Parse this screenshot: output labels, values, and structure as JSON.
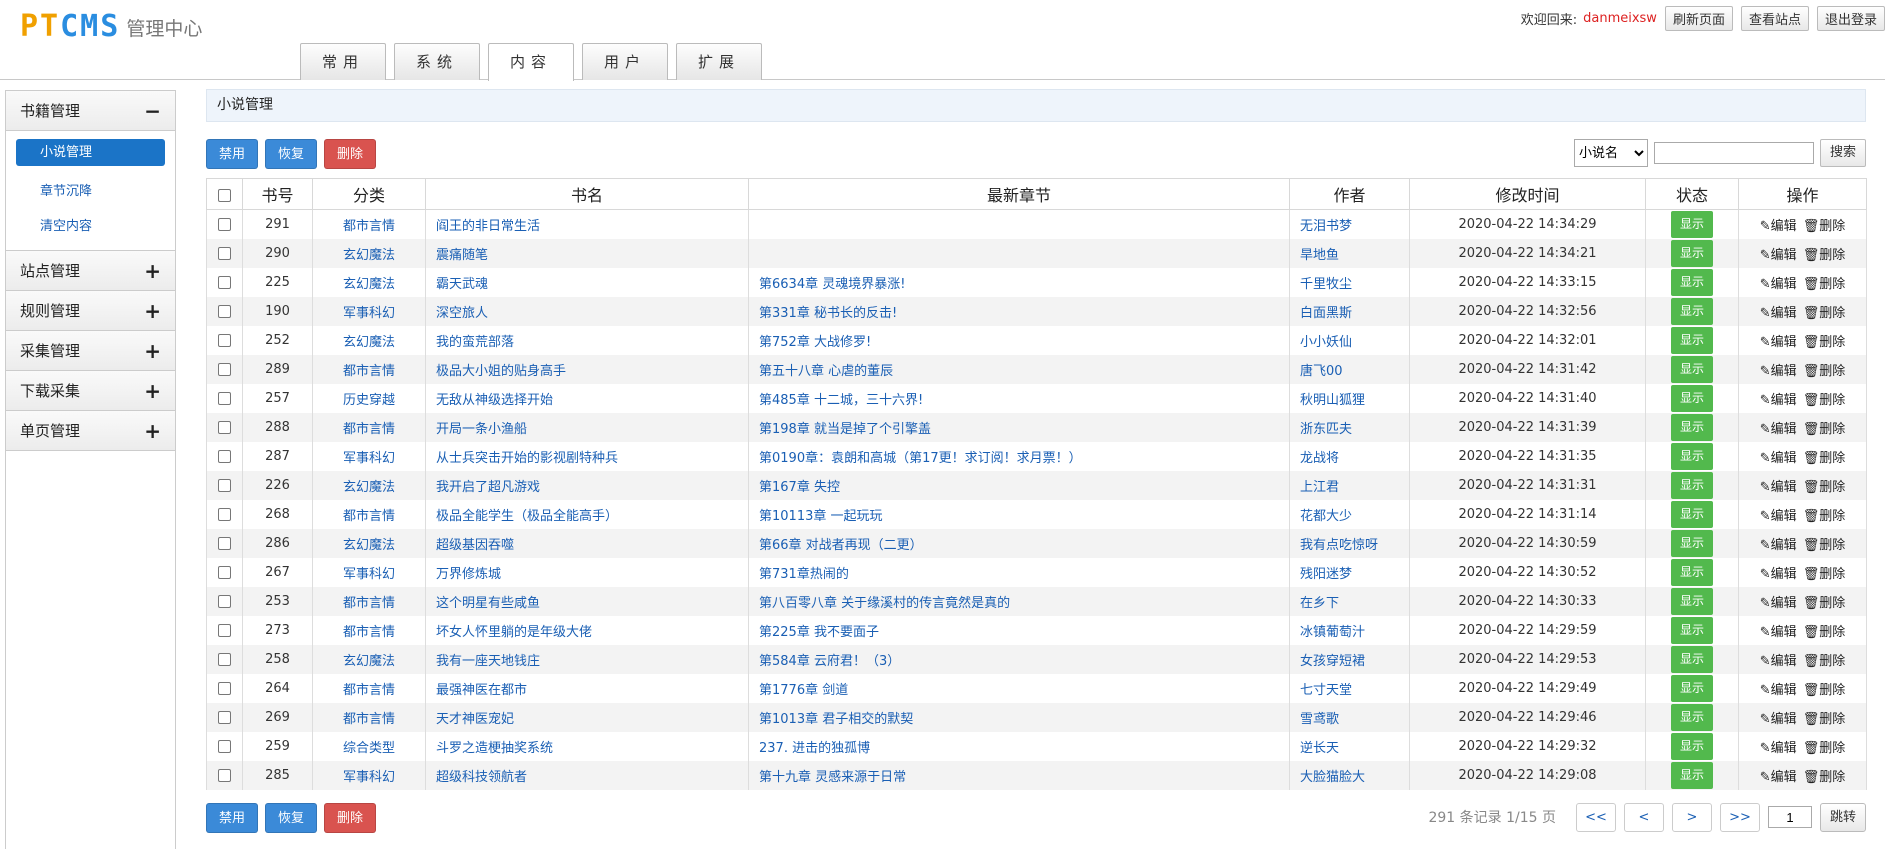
{
  "header": {
    "logo_brand_1": "PT",
    "logo_brand_2": "CMS",
    "logo_sub": "管理中心",
    "welcome": "欢迎回来:",
    "username": "danmeixsw",
    "refresh_label": "刷新页面",
    "view_site_label": "查看站点",
    "logout_label": "退出登录"
  },
  "tabs": [
    {
      "label": "常用"
    },
    {
      "label": "系统"
    },
    {
      "label": "内容"
    },
    {
      "label": "用户"
    },
    {
      "label": "扩展"
    }
  ],
  "sidebar": {
    "groups": [
      {
        "label": "书籍管理",
        "sign": "−"
      },
      {
        "label": "站点管理",
        "sign": "+"
      },
      {
        "label": "规则管理",
        "sign": "+"
      },
      {
        "label": "采集管理",
        "sign": "+"
      },
      {
        "label": "下载采集",
        "sign": "+"
      },
      {
        "label": "单页管理",
        "sign": "+"
      }
    ],
    "items": [
      {
        "label": "小说管理"
      },
      {
        "label": "章节沉降"
      },
      {
        "label": "清空内容"
      }
    ]
  },
  "main": {
    "crumb": "小说管理",
    "actions": {
      "disable": "禁用",
      "restore": "恢复",
      "delete": "删除"
    },
    "search": {
      "select_value": "小说名",
      "button": "搜索",
      "input_value": ""
    },
    "columns": [
      "书号",
      "分类",
      "书名",
      "最新章节",
      "作者",
      "修改时间",
      "状态",
      "操作"
    ],
    "status_label": "显示",
    "edit_label": "编辑",
    "delete_label": "删除",
    "rows": [
      {
        "id": "291",
        "cat": "都市言情",
        "name": "阎王的非日常生活",
        "chapter": "",
        "author": "无泪书梦",
        "time": "2020-04-22 14:34:29"
      },
      {
        "id": "290",
        "cat": "玄幻魔法",
        "name": "震痛随笔",
        "chapter": "",
        "author": "旱地鱼",
        "time": "2020-04-22 14:34:21"
      },
      {
        "id": "225",
        "cat": "玄幻魔法",
        "name": "霸天武魂",
        "chapter": "第6634章 灵魂境界暴涨!",
        "author": "千里牧尘",
        "time": "2020-04-22 14:33:15"
      },
      {
        "id": "190",
        "cat": "军事科幻",
        "name": "深空旅人",
        "chapter": "第331章 秘书长的反击!",
        "author": "白面黑斯",
        "time": "2020-04-22 14:32:56"
      },
      {
        "id": "252",
        "cat": "玄幻魔法",
        "name": "我的蛮荒部落",
        "chapter": "第752章 大战修罗!",
        "author": "小小妖仙",
        "time": "2020-04-22 14:32:01"
      },
      {
        "id": "289",
        "cat": "都市言情",
        "name": "极品大小姐的贴身高手",
        "chapter": "第五十八章 心虐的董辰",
        "author": "唐飞00",
        "time": "2020-04-22 14:31:42"
      },
      {
        "id": "257",
        "cat": "历史穿越",
        "name": "无敌从神级选择开始",
        "chapter": "第485章 十二城，三十六界!",
        "author": "秋明山狐狸",
        "time": "2020-04-22 14:31:40"
      },
      {
        "id": "288",
        "cat": "都市言情",
        "name": "开局一条小渔船",
        "chapter": "第198章 就当是掉了个引擎盖",
        "author": "浙东匹夫",
        "time": "2020-04-22 14:31:39"
      },
      {
        "id": "287",
        "cat": "军事科幻",
        "name": "从士兵突击开始的影视剧特种兵",
        "chapter": "第0190章：袁朗和高城（第17更！求订阅！求月票！）",
        "author": "龙战将",
        "time": "2020-04-22 14:31:35"
      },
      {
        "id": "226",
        "cat": "玄幻魔法",
        "name": "我开启了超凡游戏",
        "chapter": "第167章 失控",
        "author": "上江君",
        "time": "2020-04-22 14:31:31"
      },
      {
        "id": "268",
        "cat": "都市言情",
        "name": "极品全能学生（极品全能高手）",
        "chapter": "第10113章 一起玩玩",
        "author": "花都大少",
        "time": "2020-04-22 14:31:14"
      },
      {
        "id": "286",
        "cat": "玄幻魔法",
        "name": "超级基因吞噬",
        "chapter": "第66章 对战者再现（二更）",
        "author": "我有点吃惊呀",
        "time": "2020-04-22 14:30:59"
      },
      {
        "id": "267",
        "cat": "军事科幻",
        "name": "万界修炼城",
        "chapter": "第731章热闹的",
        "author": "残阳迷梦",
        "time": "2020-04-22 14:30:52"
      },
      {
        "id": "253",
        "cat": "都市言情",
        "name": "这个明星有些咸鱼",
        "chapter": "第八百零八章 关于缘溪村的传言竟然是真的",
        "author": "在乡下",
        "time": "2020-04-22 14:30:33"
      },
      {
        "id": "273",
        "cat": "都市言情",
        "name": "坏女人怀里躺的是年级大佬",
        "chapter": "第225章 我不要面子",
        "author": "冰镇葡萄汁",
        "time": "2020-04-22 14:29:59"
      },
      {
        "id": "258",
        "cat": "玄幻魔法",
        "name": "我有一座天地钱庄",
        "chapter": "第584章 云府君！（3）",
        "author": "女孩穿短裙",
        "time": "2020-04-22 14:29:53"
      },
      {
        "id": "264",
        "cat": "都市言情",
        "name": "最强神医在都市",
        "chapter": "第1776章 剑道",
        "author": "七寸天堂",
        "time": "2020-04-22 14:29:49"
      },
      {
        "id": "269",
        "cat": "都市言情",
        "name": "天才神医宠妃",
        "chapter": "第1013章 君子相交的默契",
        "author": "雪鸢歌",
        "time": "2020-04-22 14:29:46"
      },
      {
        "id": "259",
        "cat": "综合类型",
        "name": "斗罗之造梗抽奖系统",
        "chapter": "237. 进击的独孤博",
        "author": "逆长天",
        "time": "2020-04-22 14:29:32"
      },
      {
        "id": "285",
        "cat": "军事科幻",
        "name": "超级科技领航者",
        "chapter": "第十九章 灵感来源于日常",
        "author": "大脸猫脸大",
        "time": "2020-04-22 14:29:08"
      }
    ],
    "pager": {
      "info": "291 条记录 1/15 页",
      "first": "<<",
      "prev": "<",
      "next": ">",
      "last": ">>",
      "page_value": "1",
      "go": "跳转"
    }
  }
}
